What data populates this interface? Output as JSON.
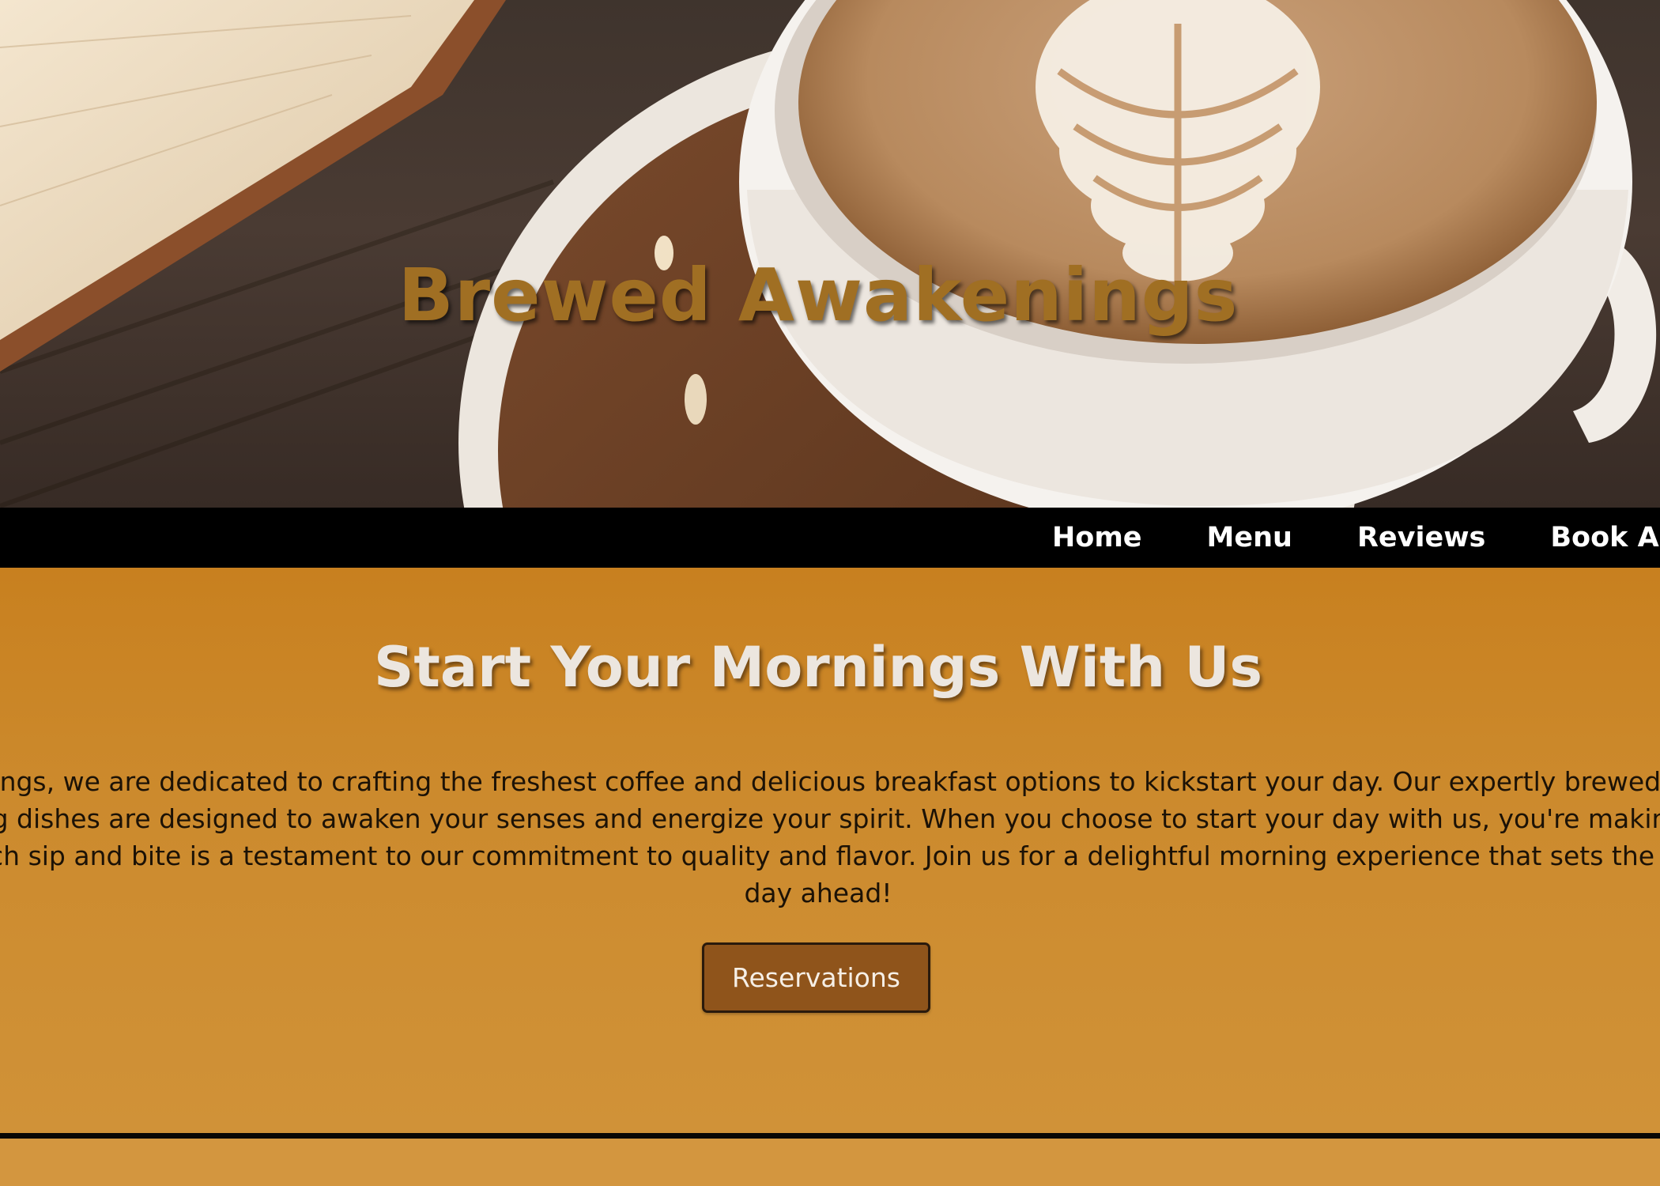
{
  "hero": {
    "title": "Brewed Awakenings",
    "image": "latte-art-coffee-cup-on-saucer-with-open-book"
  },
  "nav": {
    "items": [
      {
        "label": "Home"
      },
      {
        "label": "Menu"
      },
      {
        "label": "Reviews"
      },
      {
        "label": "Book A Rese"
      }
    ]
  },
  "intro": {
    "heading": "Start Your Mornings With Us",
    "paragraph": "enings, we are dedicated to crafting the freshest coffee and delicious breakfast options to kickstart your day. Our expertly brewed l ning dishes are designed to awaken your senses and energize your spirit. When you choose to start your day with us, you're making each sip and bite is a testament to our commitment to quality and flavor. Join us for a delightful morning experience that sets the p day ahead!",
    "lines": [
      "enings, we are dedicated to crafting the freshest coffee and delicious breakfast options to kickstart your day. Our expertly brewed l",
      "ning dishes are designed to awaken your senses and energize your spirit. When you choose to start your day with us, you're making",
      "each sip and bite is a testament to our commitment to quality and flavor. Join us for a delightful morning experience that sets the p",
      "day ahead!"
    ],
    "button_label": "Reservations"
  },
  "colors": {
    "title_gold": "#a06f23",
    "nav_bg": "#000000",
    "section_bg": "#cc8a2d",
    "button_bg": "#8f541b"
  }
}
